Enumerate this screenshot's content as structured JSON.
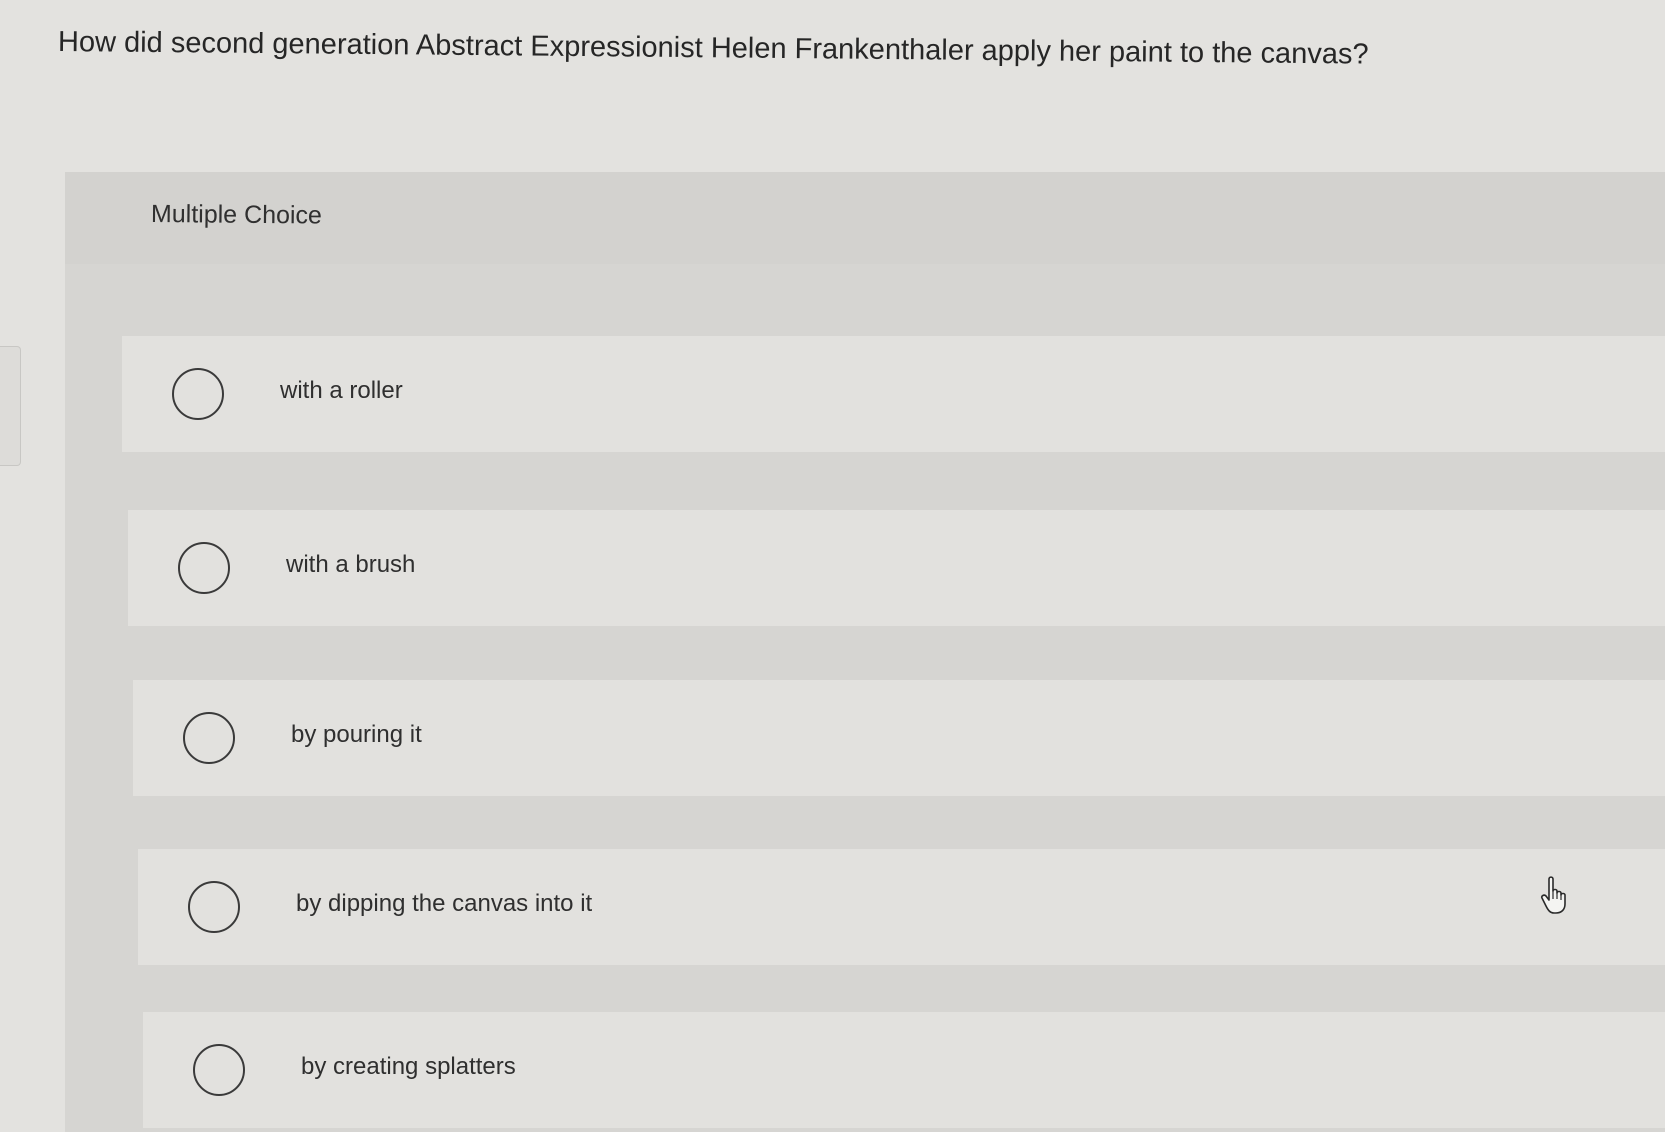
{
  "question": {
    "text": "How did second generation Abstract Expressionist Helen Frankenthaler apply her paint to the canvas?"
  },
  "panel": {
    "label": "Multiple Choice"
  },
  "options": [
    {
      "label": "with a roller"
    },
    {
      "label": "with a brush"
    },
    {
      "label": "by pouring it"
    },
    {
      "label": "by dipping the canvas into it"
    },
    {
      "label": "by creating splatters"
    }
  ],
  "icons": {
    "radio": "radio-unselected-icon",
    "cursor": "hand-pointer-icon"
  },
  "colors": {
    "page_background": "#e3e2df",
    "panel_background": "#d6d5d2",
    "option_background": "#e2e1de",
    "text": "#2b2b2b"
  }
}
